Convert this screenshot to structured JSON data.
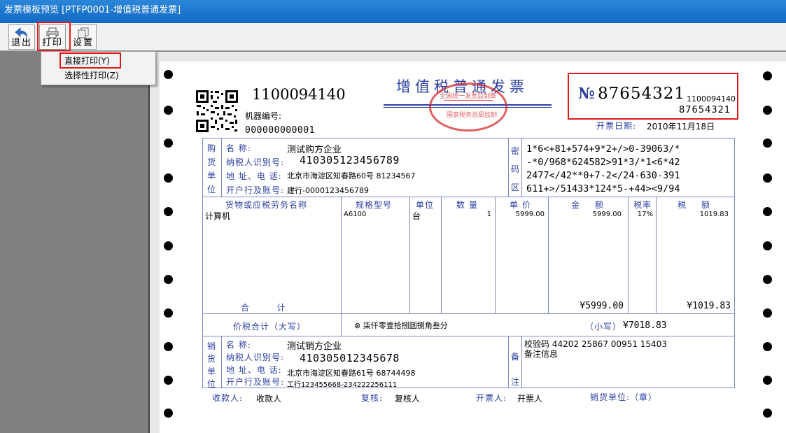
{
  "window": {
    "title": "发票模板预览 [PTFP0001-增值税普通发票]"
  },
  "toolbar": {
    "exit_label": "退出",
    "print_label": "打印",
    "settings_label": "设置"
  },
  "print_menu": {
    "items": [
      "直接打印(Y)",
      "选择性打印(Z)"
    ]
  },
  "invoice": {
    "code": "1100094140",
    "machine_label": "机器编号:",
    "machine_no": "000000000001",
    "title": "增值税普通发票",
    "seal_text_top": "全国统一发票监制章",
    "seal_text_bottom": "国家税务总局监制",
    "no_symbol": "№",
    "number": "87654321",
    "code_small": "1100094140",
    "number_small": "87654321",
    "date_label": "开票日期:",
    "date": "2010年11月18日",
    "buyer": {
      "side_label": [
        "购",
        "货",
        "单",
        "位"
      ],
      "name_label": "名      称:",
      "name": "测试购方企业",
      "taxid_label": "纳税人识别号:",
      "taxid": "410305123456789",
      "addr_label": "地 址、电 话:",
      "addr": "北京市海淀区知春路60号 81234567",
      "bank_label": "开户行及账号:",
      "bank": "建行-0000123456789"
    },
    "cipher_label": [
      "密",
      "码",
      "区"
    ],
    "cipher": [
      "1*6<+81+574+9*2+/>0-39063/*",
      "-*0/968*624582>91*3/*1<6*42",
      "2477</42**0+7-2</24-630-391",
      "611+>/51433*124*5-+44><9/94"
    ],
    "columns": [
      "货物或应税劳务名称",
      "规格型号",
      "单位",
      "数量",
      "单价",
      "金额",
      "税率",
      "税额"
    ],
    "items": [
      {
        "name": "计算机",
        "spec": "A6100",
        "unit": "台",
        "qty": "1",
        "price": "5999.00",
        "amount": "5999.00",
        "rate": "17%",
        "tax": "1019.83"
      }
    ],
    "total_label": "合        计",
    "total_amount": "¥5999.00",
    "total_tax": "¥1019.83",
    "sum_label": "价税合计（大写）",
    "sum_words": "⊗ 柒仟零壹拾捌圆捌角叁分",
    "sum_small_label": "（小写）",
    "sum_small": "¥7018.83",
    "seller": {
      "side_label": [
        "销",
        "货",
        "单",
        "位"
      ],
      "name_label": "名      称:",
      "name": "测试销方企业",
      "taxid_label": "纳税人识别号:",
      "taxid": "410305012345678",
      "addr_label": "地 址、电 话:",
      "addr": "北京市海淀区知春路61号 68744498",
      "bank_label": "开户行及账号:",
      "bank": "工行123455668-234222256111"
    },
    "remark_label": [
      "备",
      "注"
    ],
    "remark_lines": [
      "校验码 44202 25867 00951 15403",
      "备注信息"
    ],
    "payee_label": "收款人:",
    "payee": "收款人",
    "checker_label": "复核:",
    "checker": "复核人",
    "drawer_label": "开票人:",
    "drawer": "开票人",
    "seller_seal_label": "销货单位:（章）"
  },
  "colors": {
    "title_bar": "#1a74cc",
    "form_blue": "#2a3fa0",
    "seal_red": "#d62b2b",
    "highlight": "#e01818"
  }
}
